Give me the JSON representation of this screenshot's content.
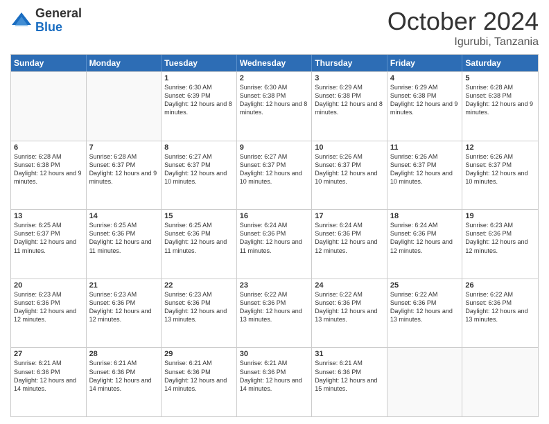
{
  "logo": {
    "general": "General",
    "blue": "Blue"
  },
  "header": {
    "month": "October 2024",
    "location": "Igurubi, Tanzania"
  },
  "days": [
    "Sunday",
    "Monday",
    "Tuesday",
    "Wednesday",
    "Thursday",
    "Friday",
    "Saturday"
  ],
  "rows": [
    [
      {
        "day": "",
        "sunrise": "",
        "sunset": "",
        "daylight": ""
      },
      {
        "day": "",
        "sunrise": "",
        "sunset": "",
        "daylight": ""
      },
      {
        "day": "1",
        "sunrise": "Sunrise: 6:30 AM",
        "sunset": "Sunset: 6:39 PM",
        "daylight": "Daylight: 12 hours and 8 minutes."
      },
      {
        "day": "2",
        "sunrise": "Sunrise: 6:30 AM",
        "sunset": "Sunset: 6:38 PM",
        "daylight": "Daylight: 12 hours and 8 minutes."
      },
      {
        "day": "3",
        "sunrise": "Sunrise: 6:29 AM",
        "sunset": "Sunset: 6:38 PM",
        "daylight": "Daylight: 12 hours and 8 minutes."
      },
      {
        "day": "4",
        "sunrise": "Sunrise: 6:29 AM",
        "sunset": "Sunset: 6:38 PM",
        "daylight": "Daylight: 12 hours and 9 minutes."
      },
      {
        "day": "5",
        "sunrise": "Sunrise: 6:28 AM",
        "sunset": "Sunset: 6:38 PM",
        "daylight": "Daylight: 12 hours and 9 minutes."
      }
    ],
    [
      {
        "day": "6",
        "sunrise": "Sunrise: 6:28 AM",
        "sunset": "Sunset: 6:38 PM",
        "daylight": "Daylight: 12 hours and 9 minutes."
      },
      {
        "day": "7",
        "sunrise": "Sunrise: 6:28 AM",
        "sunset": "Sunset: 6:37 PM",
        "daylight": "Daylight: 12 hours and 9 minutes."
      },
      {
        "day": "8",
        "sunrise": "Sunrise: 6:27 AM",
        "sunset": "Sunset: 6:37 PM",
        "daylight": "Daylight: 12 hours and 10 minutes."
      },
      {
        "day": "9",
        "sunrise": "Sunrise: 6:27 AM",
        "sunset": "Sunset: 6:37 PM",
        "daylight": "Daylight: 12 hours and 10 minutes."
      },
      {
        "day": "10",
        "sunrise": "Sunrise: 6:26 AM",
        "sunset": "Sunset: 6:37 PM",
        "daylight": "Daylight: 12 hours and 10 minutes."
      },
      {
        "day": "11",
        "sunrise": "Sunrise: 6:26 AM",
        "sunset": "Sunset: 6:37 PM",
        "daylight": "Daylight: 12 hours and 10 minutes."
      },
      {
        "day": "12",
        "sunrise": "Sunrise: 6:26 AM",
        "sunset": "Sunset: 6:37 PM",
        "daylight": "Daylight: 12 hours and 10 minutes."
      }
    ],
    [
      {
        "day": "13",
        "sunrise": "Sunrise: 6:25 AM",
        "sunset": "Sunset: 6:37 PM",
        "daylight": "Daylight: 12 hours and 11 minutes."
      },
      {
        "day": "14",
        "sunrise": "Sunrise: 6:25 AM",
        "sunset": "Sunset: 6:36 PM",
        "daylight": "Daylight: 12 hours and 11 minutes."
      },
      {
        "day": "15",
        "sunrise": "Sunrise: 6:25 AM",
        "sunset": "Sunset: 6:36 PM",
        "daylight": "Daylight: 12 hours and 11 minutes."
      },
      {
        "day": "16",
        "sunrise": "Sunrise: 6:24 AM",
        "sunset": "Sunset: 6:36 PM",
        "daylight": "Daylight: 12 hours and 11 minutes."
      },
      {
        "day": "17",
        "sunrise": "Sunrise: 6:24 AM",
        "sunset": "Sunset: 6:36 PM",
        "daylight": "Daylight: 12 hours and 12 minutes."
      },
      {
        "day": "18",
        "sunrise": "Sunrise: 6:24 AM",
        "sunset": "Sunset: 6:36 PM",
        "daylight": "Daylight: 12 hours and 12 minutes."
      },
      {
        "day": "19",
        "sunrise": "Sunrise: 6:23 AM",
        "sunset": "Sunset: 6:36 PM",
        "daylight": "Daylight: 12 hours and 12 minutes."
      }
    ],
    [
      {
        "day": "20",
        "sunrise": "Sunrise: 6:23 AM",
        "sunset": "Sunset: 6:36 PM",
        "daylight": "Daylight: 12 hours and 12 minutes."
      },
      {
        "day": "21",
        "sunrise": "Sunrise: 6:23 AM",
        "sunset": "Sunset: 6:36 PM",
        "daylight": "Daylight: 12 hours and 12 minutes."
      },
      {
        "day": "22",
        "sunrise": "Sunrise: 6:23 AM",
        "sunset": "Sunset: 6:36 PM",
        "daylight": "Daylight: 12 hours and 13 minutes."
      },
      {
        "day": "23",
        "sunrise": "Sunrise: 6:22 AM",
        "sunset": "Sunset: 6:36 PM",
        "daylight": "Daylight: 12 hours and 13 minutes."
      },
      {
        "day": "24",
        "sunrise": "Sunrise: 6:22 AM",
        "sunset": "Sunset: 6:36 PM",
        "daylight": "Daylight: 12 hours and 13 minutes."
      },
      {
        "day": "25",
        "sunrise": "Sunrise: 6:22 AM",
        "sunset": "Sunset: 6:36 PM",
        "daylight": "Daylight: 12 hours and 13 minutes."
      },
      {
        "day": "26",
        "sunrise": "Sunrise: 6:22 AM",
        "sunset": "Sunset: 6:36 PM",
        "daylight": "Daylight: 12 hours and 13 minutes."
      }
    ],
    [
      {
        "day": "27",
        "sunrise": "Sunrise: 6:21 AM",
        "sunset": "Sunset: 6:36 PM",
        "daylight": "Daylight: 12 hours and 14 minutes."
      },
      {
        "day": "28",
        "sunrise": "Sunrise: 6:21 AM",
        "sunset": "Sunset: 6:36 PM",
        "daylight": "Daylight: 12 hours and 14 minutes."
      },
      {
        "day": "29",
        "sunrise": "Sunrise: 6:21 AM",
        "sunset": "Sunset: 6:36 PM",
        "daylight": "Daylight: 12 hours and 14 minutes."
      },
      {
        "day": "30",
        "sunrise": "Sunrise: 6:21 AM",
        "sunset": "Sunset: 6:36 PM",
        "daylight": "Daylight: 12 hours and 14 minutes."
      },
      {
        "day": "31",
        "sunrise": "Sunrise: 6:21 AM",
        "sunset": "Sunset: 6:36 PM",
        "daylight": "Daylight: 12 hours and 15 minutes."
      },
      {
        "day": "",
        "sunrise": "",
        "sunset": "",
        "daylight": ""
      },
      {
        "day": "",
        "sunrise": "",
        "sunset": "",
        "daylight": ""
      }
    ]
  ]
}
